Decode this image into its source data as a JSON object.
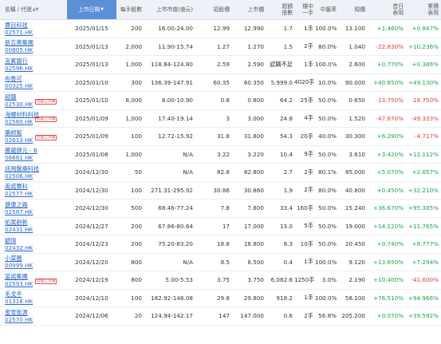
{
  "header": {
    "name_code": "名稱 / 代號",
    "list_date": "上市日期",
    "lot_size": "每手股數",
    "price_range": "上市市值(億元)",
    "offer_price": "招股價",
    "listing_price": "上市價",
    "oversub_l1": "超額",
    "oversub_l2": "倍數",
    "one_lot_l1": "穩中",
    "one_lot_l2": "一手",
    "win_rate": "中籤率",
    "grey_close": "現價",
    "first_day_l1": "首日",
    "first_day_l2": "表現",
    "cumulative_l1": "累積",
    "cumulative_l2": "表現"
  },
  "badge_text": "暗盤上市價",
  "rows": [
    {
      "name": "賽目科技",
      "code": "02571.HK",
      "badge": "",
      "date": "2025/01/15",
      "lot": "200",
      "range": "16.00-24.00",
      "offer": "12.99",
      "listing": "12.990",
      "oversub": "1.7",
      "onelot": "1手",
      "rate": "100.0%",
      "grey": "13.100",
      "first": "+1.460%",
      "first_cls": "pos",
      "cum": "+0.847%",
      "cum_cls": "pos"
    },
    {
      "name": "新吉奧集團",
      "code": "00805.HK",
      "badge": "",
      "date": "2025/01/13",
      "lot": "2,000",
      "range": "11.90-15.74",
      "offer": "1.27",
      "listing": "1.270",
      "oversub": "1.5",
      "onelot": "2手",
      "rate": "80.0%",
      "grey": "1.040",
      "first": "-22.830%",
      "first_cls": "neg",
      "cum": "+10.236%",
      "cum_cls": "pos"
    },
    {
      "name": "宜賓銀行",
      "code": "02596.HK",
      "badge": "",
      "date": "2025/01/13",
      "lot": "1,000",
      "range": "118.84-124.80",
      "offer": "2.59",
      "listing": "2.590",
      "oversub": "認購不足",
      "onelot": "1手",
      "rate": "100.0%",
      "grey": "2.600",
      "first": "+0.770%",
      "first_cls": "pos",
      "cum": "+0.386%",
      "cum_cls": "pos"
    },
    {
      "name": "布魯可",
      "code": "00325.HK",
      "badge": "",
      "date": "2025/01/10",
      "lot": "300",
      "range": "136.39-147.91",
      "offer": "60.35",
      "listing": "60.350",
      "oversub": "5,999.0",
      "onelot": "4020手",
      "rate": "10.0%",
      "grey": "90.000",
      "first": "+40.850%",
      "first_cls": "pos",
      "cum": "+49.130%",
      "cum_cls": "pos"
    },
    {
      "name": "越疆",
      "code": "02530.HK",
      "badge": "暗盤上市價",
      "date": "2025/01/10",
      "lot": "8,000",
      "range": "8.00-10.90",
      "offer": "0.8",
      "listing": "0.800",
      "oversub": "64.2",
      "onelot": "25手",
      "rate": "50.0%",
      "grey": "0.650",
      "first": "-13.750%",
      "first_cls": "neg",
      "cum": "-18.750%",
      "cum_cls": "neg"
    },
    {
      "name": "海螺材料科技",
      "code": "02560.HK",
      "badge": "暗盤上市價",
      "date": "2025/01/09",
      "lot": "1,000",
      "range": "17.40-19.14",
      "offer": "3",
      "listing": "3.000",
      "oversub": "24.8",
      "onelot": "4手",
      "rate": "50.0%",
      "grey": "1.520",
      "first": "-47.670%",
      "first_cls": "neg",
      "cum": "-49.333%",
      "cum_cls": "neg"
    },
    {
      "name": "藥師幫",
      "code": "02613.HK",
      "badge": "暗盤上市價",
      "date": "2025/01/09",
      "lot": "100",
      "range": "12.72-15.92",
      "offer": "31.8",
      "listing": "31.800",
      "oversub": "54.3",
      "onelot": "20手",
      "rate": "40.0%",
      "grey": "30.300",
      "first": "+6.290%",
      "first_cls": "pos",
      "cum": "-4.717%",
      "cum_cls": "neg"
    },
    {
      "name": "騰龍健元 - B",
      "code": "06681.HK",
      "badge": "",
      "date": "2025/01/08",
      "lot": "1,000",
      "range": "N/A",
      "offer": "3.22",
      "listing": "3.220",
      "oversub": "10.4",
      "onelot": "9手",
      "rate": "50.0%",
      "grey": "3.610",
      "first": "+3.420%",
      "first_cls": "pos",
      "cum": "+12.112%",
      "cum_cls": "pos"
    },
    {
      "name": "訊飛醫療科技",
      "code": "02506.HK",
      "badge": "",
      "date": "2024/12/30",
      "lot": "50",
      "range": "N/A",
      "offer": "82.8",
      "listing": "82.800",
      "oversub": "2.7",
      "onelot": "2手",
      "rate": "80.1%",
      "grey": "85.000",
      "first": "+5.070%",
      "first_cls": "pos",
      "cum": "+2.657%",
      "cum_cls": "pos"
    },
    {
      "name": "英諾賽科",
      "code": "02577.HK",
      "badge": "",
      "date": "2024/12/30",
      "lot": "100",
      "range": "271.31-295.92",
      "offer": "30.86",
      "listing": "30.860",
      "oversub": "1.9",
      "onelot": "2手",
      "rate": "80.0%",
      "grey": "40.800",
      "first": "+0.450%",
      "first_cls": "pos",
      "cum": "+32.210%",
      "cum_cls": "pos"
    },
    {
      "name": "健康之路",
      "code": "02587.HK",
      "badge": "",
      "date": "2024/12/30",
      "lot": "500",
      "range": "68.46-77.24",
      "offer": "7.8",
      "listing": "7.800",
      "oversub": "33.4",
      "onelot": "160手",
      "rate": "50.0%",
      "grey": "15.240",
      "first": "+36.670%",
      "first_cls": "pos",
      "cum": "+95.385%",
      "cum_cls": "pos"
    },
    {
      "name": "佑駕創新",
      "code": "02431.HK",
      "badge": "",
      "date": "2024/12/27",
      "lot": "200",
      "range": "67.86-80.64",
      "offer": "17",
      "listing": "17.000",
      "oversub": "13.0",
      "onelot": "5手",
      "rate": "50.0%",
      "grey": "19.000",
      "first": "+14.120%",
      "first_cls": "pos",
      "cum": "+11.765%",
      "cum_cls": "pos"
    },
    {
      "name": "穎瑋",
      "code": "02432.HK",
      "badge": "",
      "date": "2024/12/23",
      "lot": "200",
      "range": "75.20-83.20",
      "offer": "18.8",
      "listing": "18.800",
      "oversub": "8.3",
      "onelot": "10手",
      "rate": "50.0%",
      "grey": "20.450",
      "first": "+0.740%",
      "first_cls": "pos",
      "cum": "+8.777%",
      "cum_cls": "pos"
    },
    {
      "name": "小菜園",
      "code": "00999.HK",
      "badge": "",
      "date": "2024/12/20",
      "lot": "800",
      "range": "N/A",
      "offer": "8.5",
      "listing": "8.500",
      "oversub": "0.4",
      "onelot": "1手",
      "rate": "100.0%",
      "grey": "9.120",
      "first": "+13.650%",
      "first_cls": "pos",
      "cum": "+7.294%",
      "cum_cls": "pos"
    },
    {
      "name": "富諾集團",
      "code": "02593.HK",
      "badge": "暗盤上市價",
      "date": "2024/12/19",
      "lot": "800",
      "range": "5.00-5.53",
      "offer": "3.75",
      "listing": "3.750",
      "oversub": "6,082.6",
      "onelot": "1250手",
      "rate": "3.0%",
      "grey": "2.190",
      "first": "+10.400%",
      "first_cls": "pos",
      "cum": "-41.600%",
      "cum_cls": "neg"
    },
    {
      "name": "毛戈平",
      "code": "01318.HK",
      "badge": "",
      "date": "2024/12/10",
      "lot": "100",
      "range": "182.92-146.08",
      "offer": "29.8",
      "listing": "29.800",
      "oversub": "918.2",
      "onelot": "1手",
      "rate": "100.0%",
      "grey": "58.100",
      "first": "+76.510%",
      "first_cls": "pos",
      "cum": "+94.966%",
      "cum_cls": "pos"
    },
    {
      "name": "蜜雪能源",
      "code": "02570.HK",
      "badge": "",
      "date": "2024/12/06",
      "lot": "20",
      "range": "124.94-142.17",
      "offer": "147",
      "listing": "147.000",
      "oversub": "0.6",
      "onelot": "2手",
      "rate": "56.8%",
      "grey": "205.200",
      "first": "+0.070%",
      "first_cls": "pos",
      "cum": "+39.592%",
      "cum_cls": "pos"
    }
  ]
}
